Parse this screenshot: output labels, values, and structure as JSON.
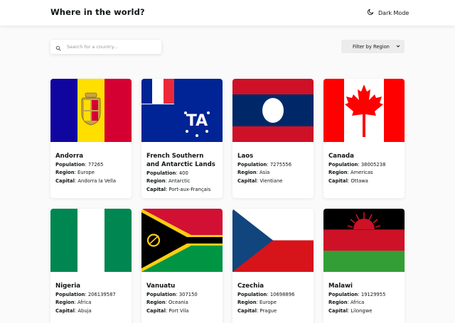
{
  "header": {
    "title": "Where in the world?",
    "dark_mode_label": "Dark Mode"
  },
  "search": {
    "placeholder": "Search for a country...",
    "value": ""
  },
  "filter": {
    "label": "Filter by Region"
  },
  "labels": {
    "population": "Population",
    "region": "Region",
    "capital": "Capital"
  },
  "countries": [
    {
      "name": "Andorra",
      "population": "77265",
      "region": "Europe",
      "capital": "Andorra la Vella"
    },
    {
      "name": "French Southern and Antarctic Lands",
      "population": "400",
      "region": "Antarctic",
      "capital": "Port-aux-Français"
    },
    {
      "name": "Laos",
      "population": "7275556",
      "region": "Asia",
      "capital": "Vientiane"
    },
    {
      "name": "Canada",
      "population": "38005238",
      "region": "Americas",
      "capital": "Ottawa"
    },
    {
      "name": "Nigeria",
      "population": "206139587",
      "region": "Africa",
      "capital": "Abuja"
    },
    {
      "name": "Vanuatu",
      "population": "307150",
      "region": "Oceania",
      "capital": "Port Vila"
    },
    {
      "name": "Czechia",
      "population": "10698896",
      "region": "Europe",
      "capital": "Prague"
    },
    {
      "name": "Malawi",
      "population": "19129955",
      "region": "Africa",
      "capital": "Lilongwe"
    }
  ],
  "colors": {
    "background": "#fafafa",
    "element": "#ffffff",
    "text": "#111517",
    "placeholder": "#9a9a9a",
    "filter_bg": "#ececec"
  }
}
